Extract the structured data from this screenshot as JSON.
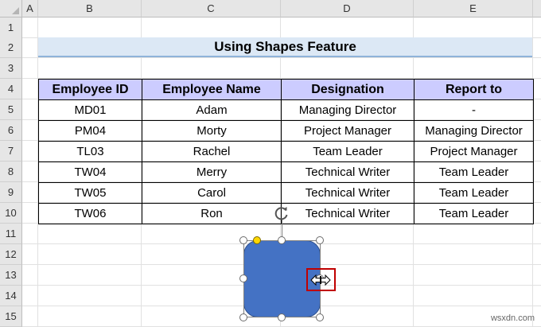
{
  "columns": [
    "A",
    "B",
    "C",
    "D",
    "E"
  ],
  "rows": [
    "1",
    "2",
    "3",
    "4",
    "5",
    "6",
    "7",
    "8",
    "9",
    "10",
    "11",
    "12",
    "13",
    "14",
    "15"
  ],
  "title": "Using Shapes Feature",
  "table": {
    "headers": [
      "Employee ID",
      "Employee Name",
      "Designation",
      "Report to"
    ],
    "rows": [
      [
        "MD01",
        "Adam",
        "Managing Director",
        "-"
      ],
      [
        "PM04",
        "Morty",
        "Project Manager",
        "Managing Director"
      ],
      [
        "TL03",
        "Rachel",
        "Team Leader",
        "Project Manager"
      ],
      [
        "TW04",
        "Merry",
        "Technical Writer",
        "Team Leader"
      ],
      [
        "TW05",
        "Carol",
        "Technical Writer",
        "Team Leader"
      ],
      [
        "TW06",
        "Ron",
        "Technical Writer",
        "Team Leader"
      ]
    ]
  },
  "shape": {
    "fill": "#4472c4",
    "type": "rounded-rectangle"
  },
  "icons": {
    "rotate": "rotate-handle-icon",
    "cursor": "resize-horizontal-cursor-icon"
  },
  "highlight_color": "#c00000",
  "watermark": "wsxdn.com"
}
